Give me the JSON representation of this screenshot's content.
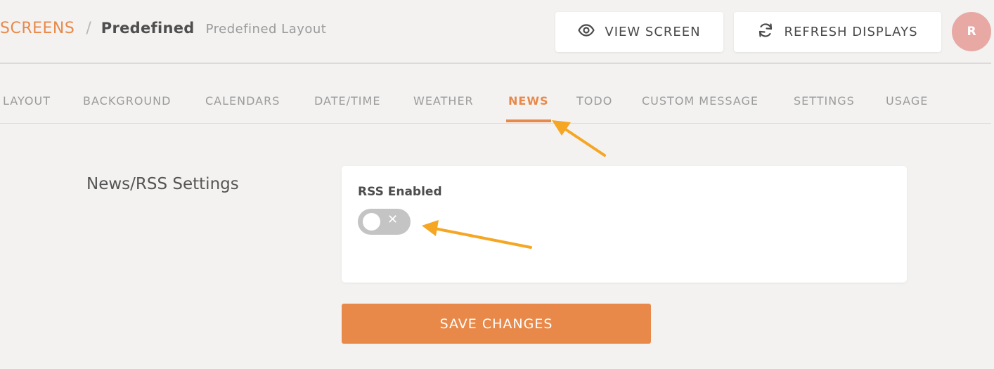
{
  "breadcrumb": {
    "root": "SCREENS",
    "separator": "/",
    "current": "Predefined",
    "subtitle": "Predefined Layout"
  },
  "header": {
    "view_screen_label": "VIEW SCREEN",
    "view_screen_icon": "eye-icon",
    "refresh_label": "REFRESH DISPLAYS",
    "refresh_icon": "refresh-icon",
    "avatar_initial": "R"
  },
  "tabs": [
    {
      "label": "LAYOUT",
      "active": false
    },
    {
      "label": "BACKGROUND",
      "active": false
    },
    {
      "label": "CALENDARS",
      "active": false
    },
    {
      "label": "DATE/TIME",
      "active": false
    },
    {
      "label": "WEATHER",
      "active": false
    },
    {
      "label": "NEWS",
      "active": true
    },
    {
      "label": "TODO",
      "active": false
    },
    {
      "label": "CUSTOM MESSAGE",
      "active": false
    },
    {
      "label": "SETTINGS",
      "active": false
    },
    {
      "label": "USAGE",
      "active": false
    }
  ],
  "settings": {
    "section_title": "News/RSS Settings",
    "rss_label": "RSS Enabled",
    "rss_enabled": false,
    "toggle_off_symbol": "✕"
  },
  "save_label": "SAVE CHANGES",
  "colors": {
    "accent": "#e8894a",
    "avatar": "#e8a9a4",
    "annotation_arrow": "#f5a623",
    "toggle_off": "#c4c4c4"
  }
}
